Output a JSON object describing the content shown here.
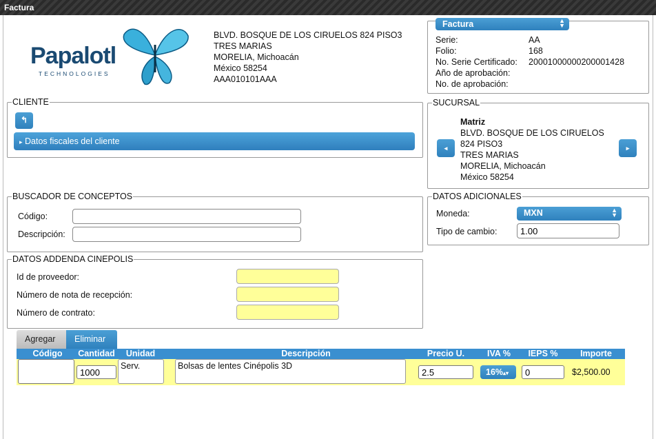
{
  "window": {
    "title": "Factura"
  },
  "logo": {
    "name": "Papalotl",
    "tagline": "TECHNOLOGIES"
  },
  "emisor": {
    "lines": [
      "BLVD. BOSQUE DE LOS CIRUELOS 824 PISO3",
      "TRES MARIAS",
      "MORELIA, Michoacán",
      "México 58254",
      "AAA010101AAA"
    ]
  },
  "factura": {
    "select_value": "Factura",
    "serie_label": "Serie:",
    "serie_value": "AA",
    "folio_label": "Folio:",
    "folio_value": "168",
    "certificado_label": "No. Serie Certificado:",
    "certificado_value": "20001000000200001428",
    "anio_label": "Año de aprobación:",
    "anio_value": "",
    "aprobacion_label": "No. de aprobación:",
    "aprobacion_value": ""
  },
  "cliente": {
    "legend": "CLIENTE",
    "back_icon": "undo-arrow-icon",
    "collapse_label": "Datos fiscales del cliente"
  },
  "sucursal": {
    "legend": "SUCURSAL",
    "name": "Matriz",
    "lines": [
      "BLVD. BOSQUE DE LOS CIRUELOS",
      "824 PISO3",
      "TRES MARIAS",
      "MORELIA, Michoacán",
      "México 58254"
    ],
    "prev_icon": "chevron-left-icon",
    "next_icon": "chevron-right-icon"
  },
  "buscador": {
    "legend": "BUSCADOR DE CONCEPTOS",
    "codigo_label": "Código:",
    "codigo_value": "",
    "descripcion_label": "Descripción:",
    "descripcion_value": ""
  },
  "adicionales": {
    "legend": "DATOS ADICIONALES",
    "moneda_label": "Moneda:",
    "moneda_value": "MXN",
    "tipo_label": "Tipo de cambio:",
    "tipo_value": "1.00"
  },
  "addenda": {
    "legend": "DATOS ADDENDA CINEPOLIS",
    "proveedor_label": "Id de proveedor:",
    "proveedor_value": "",
    "nota_label": "Número de nota de recepción:",
    "nota_value": "",
    "contrato_label": "Número de contrato:",
    "contrato_value": ""
  },
  "tabs": {
    "agregar": "Agregar",
    "eliminar": "Eliminar"
  },
  "table": {
    "headers": [
      "Código",
      "Cantidad",
      "Unidad",
      "Descripción",
      "Precio U.",
      "IVA %",
      "IEPS %",
      "Importe"
    ],
    "rows": [
      {
        "codigo": "",
        "cantidad": "1000",
        "unidad": "Serv.",
        "descripcion": "Bolsas de lentes Cinépolis 3D",
        "precio": "2.5",
        "iva": "16%",
        "ieps": "0",
        "importe": "$2,500.00"
      }
    ]
  },
  "colors": {
    "accent": "#3a8fd0",
    "highlight": "#ffff99"
  }
}
